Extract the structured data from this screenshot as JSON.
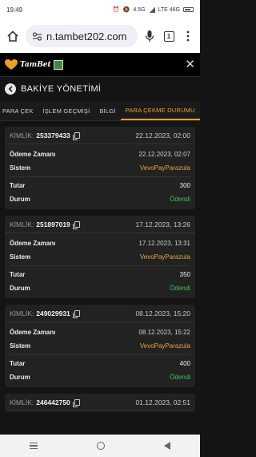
{
  "status_bar": {
    "time": "19:49",
    "signal_text": "4.5G",
    "net_text": "LTE 46G"
  },
  "browser": {
    "url": "n.tambet202.com",
    "tabs_count": "1"
  },
  "site": {
    "brand": "TamBet"
  },
  "page": {
    "title": "BAKİYE YÖNETİMİ"
  },
  "tabs": [
    {
      "label": "PARA ÇEK",
      "active": false
    },
    {
      "label": "İŞLEM GEÇMİŞİ",
      "active": false
    },
    {
      "label": "BİLGİ",
      "active": false
    },
    {
      "label": "PARA ÇEKME DURUMU",
      "active": true
    }
  ],
  "labels": {
    "kimlik": "KİMLİK:",
    "odeme_zamani": "Ödeme Zamanı",
    "sistem": "Sistem",
    "tutar": "Tutar",
    "durum": "Durum"
  },
  "withdrawals": [
    {
      "id": "253379433",
      "date": "22.12.2023, 02:00",
      "payment_time": "22.12.2023, 02:07",
      "system": "VevoPayParazula",
      "amount": "300",
      "status": "Ödendi"
    },
    {
      "id": "251897019",
      "date": "17.12.2023, 13:26",
      "payment_time": "17.12.2023, 13:31",
      "system": "VevoPayParazula",
      "amount": "350",
      "status": "Ödendi"
    },
    {
      "id": "249029931",
      "date": "08.12.2023, 15:20",
      "payment_time": "08.12.2023, 15:22",
      "system": "VevoPayParazula",
      "amount": "400",
      "status": "Ödendi"
    },
    {
      "id": "246442750",
      "date": "01.12.2023, 02:51"
    }
  ],
  "colors": {
    "accent": "#f0a020",
    "system": "#e8a23a",
    "paid": "#3cc05a",
    "background": "#141414",
    "card": "#222222"
  }
}
